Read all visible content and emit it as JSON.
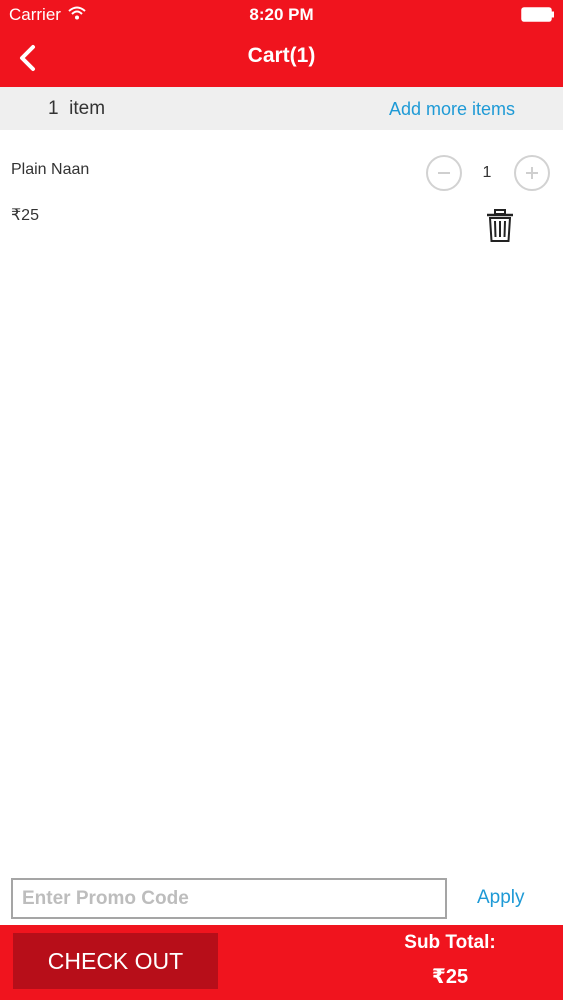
{
  "status_bar": {
    "carrier": "Carrier",
    "time": "8:20 PM",
    "wifi_icon": "wifi-icon",
    "battery_icon": "battery-icon"
  },
  "nav": {
    "title": "Cart(1)",
    "back_icon": "chevron-left-icon"
  },
  "summary": {
    "item_count": "1  item",
    "add_more_label": "Add more items"
  },
  "cart": {
    "items": [
      {
        "name": "Plain Naan",
        "price": "₹25",
        "quantity": "1",
        "icons": [
          "minus-circle-icon",
          "plus-circle-icon",
          "trash-icon"
        ]
      }
    ]
  },
  "promo": {
    "placeholder": "Enter Promo Code",
    "value": "",
    "apply_label": "Apply"
  },
  "footer": {
    "checkout_label": "CHECK OUT",
    "subtotal_label": "Sub Total:",
    "subtotal_value": "₹25"
  },
  "colors": {
    "brand_red": "#f0141e",
    "checkout_red": "#b70e19",
    "link_blue": "#1e9ad6",
    "summary_bg": "#efefef"
  }
}
